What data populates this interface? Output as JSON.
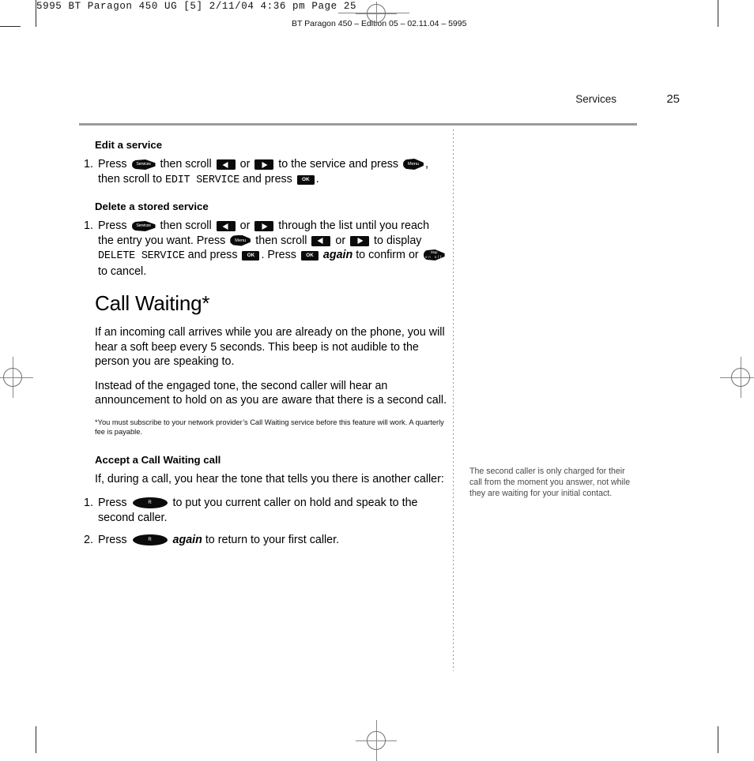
{
  "prepress": {
    "strip_text": "5995 BT Paragon 450 UG [5]  2/11/04  4:36 pm  Page 25",
    "edition_text": "BT Paragon 450 – Edition 05 – 02.11.04 – 5995"
  },
  "header": {
    "section": "Services",
    "page_number": "25"
  },
  "keys": {
    "services": "Services",
    "menu": "Menu",
    "ok": "OK",
    "stop_line1": "Stop",
    "stop_line2": "on off",
    "r": "R"
  },
  "main": {
    "sections": [
      {
        "heading": "Edit a service",
        "steps": [
          {
            "num": "1.",
            "parts": [
              {
                "t": "text",
                "v": "Press "
              },
              {
                "t": "key",
                "v": "services"
              },
              {
                "t": "text",
                "v": " then scroll "
              },
              {
                "t": "key",
                "v": "arrow-left"
              },
              {
                "t": "text",
                "v": " or "
              },
              {
                "t": "key",
                "v": "arrow-right"
              },
              {
                "t": "text",
                "v": " to the service and press "
              },
              {
                "t": "key",
                "v": "menu"
              },
              {
                "t": "text",
                "v": ", then scroll to "
              },
              {
                "t": "lcd",
                "v": "EDIT SERVICE"
              },
              {
                "t": "text",
                "v": " and press "
              },
              {
                "t": "key",
                "v": "ok"
              },
              {
                "t": "text",
                "v": "."
              }
            ]
          }
        ]
      },
      {
        "heading": "Delete a stored service",
        "steps": [
          {
            "num": "1.",
            "parts": [
              {
                "t": "text",
                "v": "Press "
              },
              {
                "t": "key",
                "v": "services"
              },
              {
                "t": "text",
                "v": " then scroll "
              },
              {
                "t": "key",
                "v": "arrow-left"
              },
              {
                "t": "text",
                "v": " or "
              },
              {
                "t": "key",
                "v": "arrow-right"
              },
              {
                "t": "text",
                "v": " through the list until you reach the entry you want. Press "
              },
              {
                "t": "key",
                "v": "menu"
              },
              {
                "t": "text",
                "v": " then scroll "
              },
              {
                "t": "key",
                "v": "arrow-left"
              },
              {
                "t": "text",
                "v": " or "
              },
              {
                "t": "key",
                "v": "arrow-right"
              },
              {
                "t": "text",
                "v": " to display "
              },
              {
                "t": "lcd",
                "v": "DELETE SERVICE"
              },
              {
                "t": "text",
                "v": " and press "
              },
              {
                "t": "key",
                "v": "ok"
              },
              {
                "t": "text",
                "v": ". Press "
              },
              {
                "t": "key",
                "v": "ok"
              },
              {
                "t": "text",
                "v": " "
              },
              {
                "t": "ital",
                "v": "again"
              },
              {
                "t": "text",
                "v": " to confirm or "
              },
              {
                "t": "key",
                "v": "stop"
              },
              {
                "t": "text",
                "v": " to cancel."
              }
            ]
          }
        ]
      }
    ],
    "chapter_title": "Call Waiting*",
    "chapter_paragraphs": [
      "If an incoming call arrives while you are already on the phone, you will hear a soft beep every 5 seconds. This beep is not audible to the person you are speaking to.",
      "Instead of the engaged tone, the second caller will hear an announcement to hold on as you are aware that there is a second call."
    ],
    "footnote": "*You must subscribe to your network provider’s Call Waiting service before this feature will work. A quarterly fee is payable.",
    "accept_section": {
      "heading": "Accept a Call Waiting call",
      "intro": "If, during a call, you hear the tone that tells you there is another caller:",
      "steps": [
        {
          "num": "1.",
          "parts": [
            {
              "t": "text",
              "v": "Press "
            },
            {
              "t": "key",
              "v": "r"
            },
            {
              "t": "text",
              "v": " to put you current caller on hold and speak to the second caller."
            }
          ]
        },
        {
          "num": "2.",
          "parts": [
            {
              "t": "text",
              "v": "Press "
            },
            {
              "t": "key",
              "v": "r"
            },
            {
              "t": "text",
              "v": " "
            },
            {
              "t": "ital",
              "v": "again"
            },
            {
              "t": "text",
              "v": " to return to your first caller."
            }
          ]
        }
      ]
    }
  },
  "sidenote": "The second caller is only charged for their call from the moment you answer, not while they are waiting for your initial contact."
}
